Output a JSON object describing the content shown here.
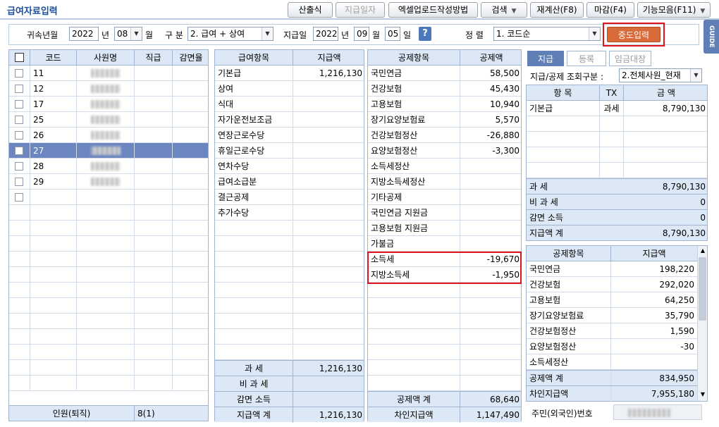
{
  "app": {
    "title": "급여자료입력"
  },
  "toolbar": [
    {
      "label": "산출식",
      "disabled": false,
      "dropdown": false
    },
    {
      "label": "지급일자",
      "disabled": true,
      "dropdown": false
    },
    {
      "label": "엑셀업로드작성방법",
      "disabled": false,
      "dropdown": false
    },
    {
      "label": "검색",
      "disabled": false,
      "dropdown": true
    },
    {
      "label": "재계산(F8)",
      "disabled": false,
      "dropdown": false
    },
    {
      "label": "마감(F4)",
      "disabled": false,
      "dropdown": false
    },
    {
      "label": "기능모음(F11)",
      "disabled": false,
      "dropdown": true
    }
  ],
  "guide_label": "GUIDE",
  "filter": {
    "year_month_label": "귀속년월",
    "year": "2022",
    "year_unit": "년",
    "month": "08",
    "month_unit": "월",
    "category_label": "구 분",
    "category_value": "2. 급여 + 상여",
    "pay_date_label": "지급일",
    "pay_year": "2022",
    "pay_year_unit": "년",
    "pay_month": "09",
    "pay_month_unit": "월",
    "pay_day": "05",
    "pay_day_unit": "일",
    "help": "?",
    "sort_label": "정 렬",
    "sort_value": "1. 코드순",
    "mid_input_button": "중도입력"
  },
  "employees": {
    "headers": [
      "코드",
      "사원명",
      "직급",
      "감면율"
    ],
    "rows": [
      {
        "code": "11"
      },
      {
        "code": "12"
      },
      {
        "code": "17"
      },
      {
        "code": "25"
      },
      {
        "code": "26"
      },
      {
        "code": "27",
        "selected": true
      },
      {
        "code": "28"
      },
      {
        "code": "29"
      }
    ],
    "footer_label": "인원(퇴직)",
    "footer_value": "8(1)"
  },
  "pay_items": {
    "headers": [
      "급여항목",
      "지급액"
    ],
    "rows": [
      {
        "item": "기본급",
        "amount": "1,216,130"
      },
      {
        "item": "상여",
        "amount": ""
      },
      {
        "item": "식대",
        "amount": ""
      },
      {
        "item": "자가운전보조금",
        "amount": ""
      },
      {
        "item": "연장근로수당",
        "amount": ""
      },
      {
        "item": "휴일근로수당",
        "amount": ""
      },
      {
        "item": "연차수당",
        "amount": ""
      },
      {
        "item": "급여소급분",
        "amount": ""
      },
      {
        "item": "결근공제",
        "amount": ""
      },
      {
        "item": "추가수당",
        "amount": ""
      }
    ],
    "summary": [
      {
        "label": "과 세",
        "value": "1,216,130"
      },
      {
        "label": "비 과 세",
        "value": ""
      },
      {
        "label": "감면 소득",
        "value": ""
      },
      {
        "label": "지급액 계",
        "value": "1,216,130"
      }
    ]
  },
  "deductions": {
    "headers": [
      "공제항목",
      "공제액"
    ],
    "rows": [
      {
        "item": "국민연금",
        "amount": "58,500"
      },
      {
        "item": "건강보험",
        "amount": "45,430"
      },
      {
        "item": "고용보험",
        "amount": "10,940"
      },
      {
        "item": "장기요양보험료",
        "amount": "5,570"
      },
      {
        "item": "건강보험정산",
        "amount": "-26,880"
      },
      {
        "item": "요양보험정산",
        "amount": "-3,300"
      },
      {
        "item": "소득세정산",
        "amount": ""
      },
      {
        "item": "지방소득세정산",
        "amount": ""
      },
      {
        "item": "기타공제",
        "amount": ""
      },
      {
        "item": "국민연금 지원금",
        "amount": ""
      },
      {
        "item": "고용보험 지원금",
        "amount": ""
      },
      {
        "item": "가불금",
        "amount": ""
      },
      {
        "item": "소득세",
        "amount": "-19,670"
      },
      {
        "item": "지방소득세",
        "amount": "-1,950"
      }
    ],
    "summary": [
      {
        "label": "공제액 계",
        "value": "68,640"
      },
      {
        "label": "차인지급액",
        "value": "1,147,490"
      }
    ]
  },
  "side": {
    "tabs": [
      {
        "label": "지급",
        "active": true
      },
      {
        "label": "등록",
        "active": false
      },
      {
        "label": "임금대장",
        "active": false
      }
    ],
    "query_label": "지급/공제 조회구분 :",
    "query_value": "2.전체사원_현재",
    "pay_headers": [
      "항 목",
      "TX",
      "금 액"
    ],
    "pay_rows": [
      {
        "item": "기본급",
        "tx": "과세",
        "amount": "8,790,130"
      }
    ],
    "pay_summary": [
      {
        "label": "과 세",
        "value": "8,790,130"
      },
      {
        "label": "비 과 세",
        "value": "0"
      },
      {
        "label": "감면 소득",
        "value": "0"
      },
      {
        "label": "지급액 계",
        "value": "8,790,130"
      }
    ],
    "ded_headers": [
      "공제항목",
      "지급액"
    ],
    "ded_rows": [
      {
        "item": "국민연금",
        "amount": "198,220"
      },
      {
        "item": "건강보험",
        "amount": "292,020"
      },
      {
        "item": "고용보험",
        "amount": "64,250"
      },
      {
        "item": "장기요양보험료",
        "amount": "35,790"
      },
      {
        "item": "건강보험정산",
        "amount": "1,590"
      },
      {
        "item": "요양보험정산",
        "amount": "-30"
      },
      {
        "item": "소득세정산",
        "amount": ""
      },
      {
        "item": "공제액 계",
        "amount": "834,950"
      },
      {
        "item": "차인지급액",
        "amount": "7,955,180"
      }
    ],
    "resident_label": "주민(외국인)번호"
  },
  "colors": {
    "header_bg": "#dce8f5",
    "selected_row": "#6b86c0",
    "accent": "#5f7fb6",
    "highlight": "#e0141c"
  }
}
